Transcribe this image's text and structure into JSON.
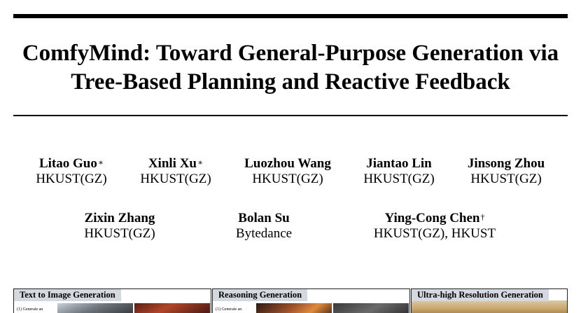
{
  "paper": {
    "title_line1": "ComfyMind: Toward General-Purpose Generation via",
    "title_line2": "Tree-Based Planning and Reactive Feedback"
  },
  "authors_row1": [
    {
      "name": "Litao Guo",
      "mark": "∗",
      "affiliation": "HKUST(GZ)"
    },
    {
      "name": "Xinli Xu",
      "mark": "∗",
      "affiliation": "HKUST(GZ)"
    },
    {
      "name": "Luozhou Wang",
      "mark": "",
      "affiliation": "HKUST(GZ)"
    },
    {
      "name": "Jiantao Lin",
      "mark": "",
      "affiliation": "HKUST(GZ)"
    },
    {
      "name": "Jinsong Zhou",
      "mark": "",
      "affiliation": "HKUST(GZ)"
    }
  ],
  "authors_row2": [
    {
      "name": "Zixin Zhang",
      "mark": "",
      "affiliation": "HKUST(GZ)"
    },
    {
      "name": "Bolan Su",
      "mark": "",
      "affiliation": "Bytedance"
    },
    {
      "name": "Ying-Cong Chen",
      "mark": "†",
      "affiliation": "HKUST(GZ), HKUST"
    }
  ],
  "figure": {
    "panels": [
      {
        "label": "Text to Image Generation",
        "note": "(1) Generate an"
      },
      {
        "label": "Reasoning Generation",
        "note": "(1) Generate an"
      },
      {
        "label": "Ultra-high Resolution Generation",
        "note": ""
      }
    ],
    "colors": {
      "label_bg": "#d4d9df",
      "rule": "#000000"
    }
  }
}
